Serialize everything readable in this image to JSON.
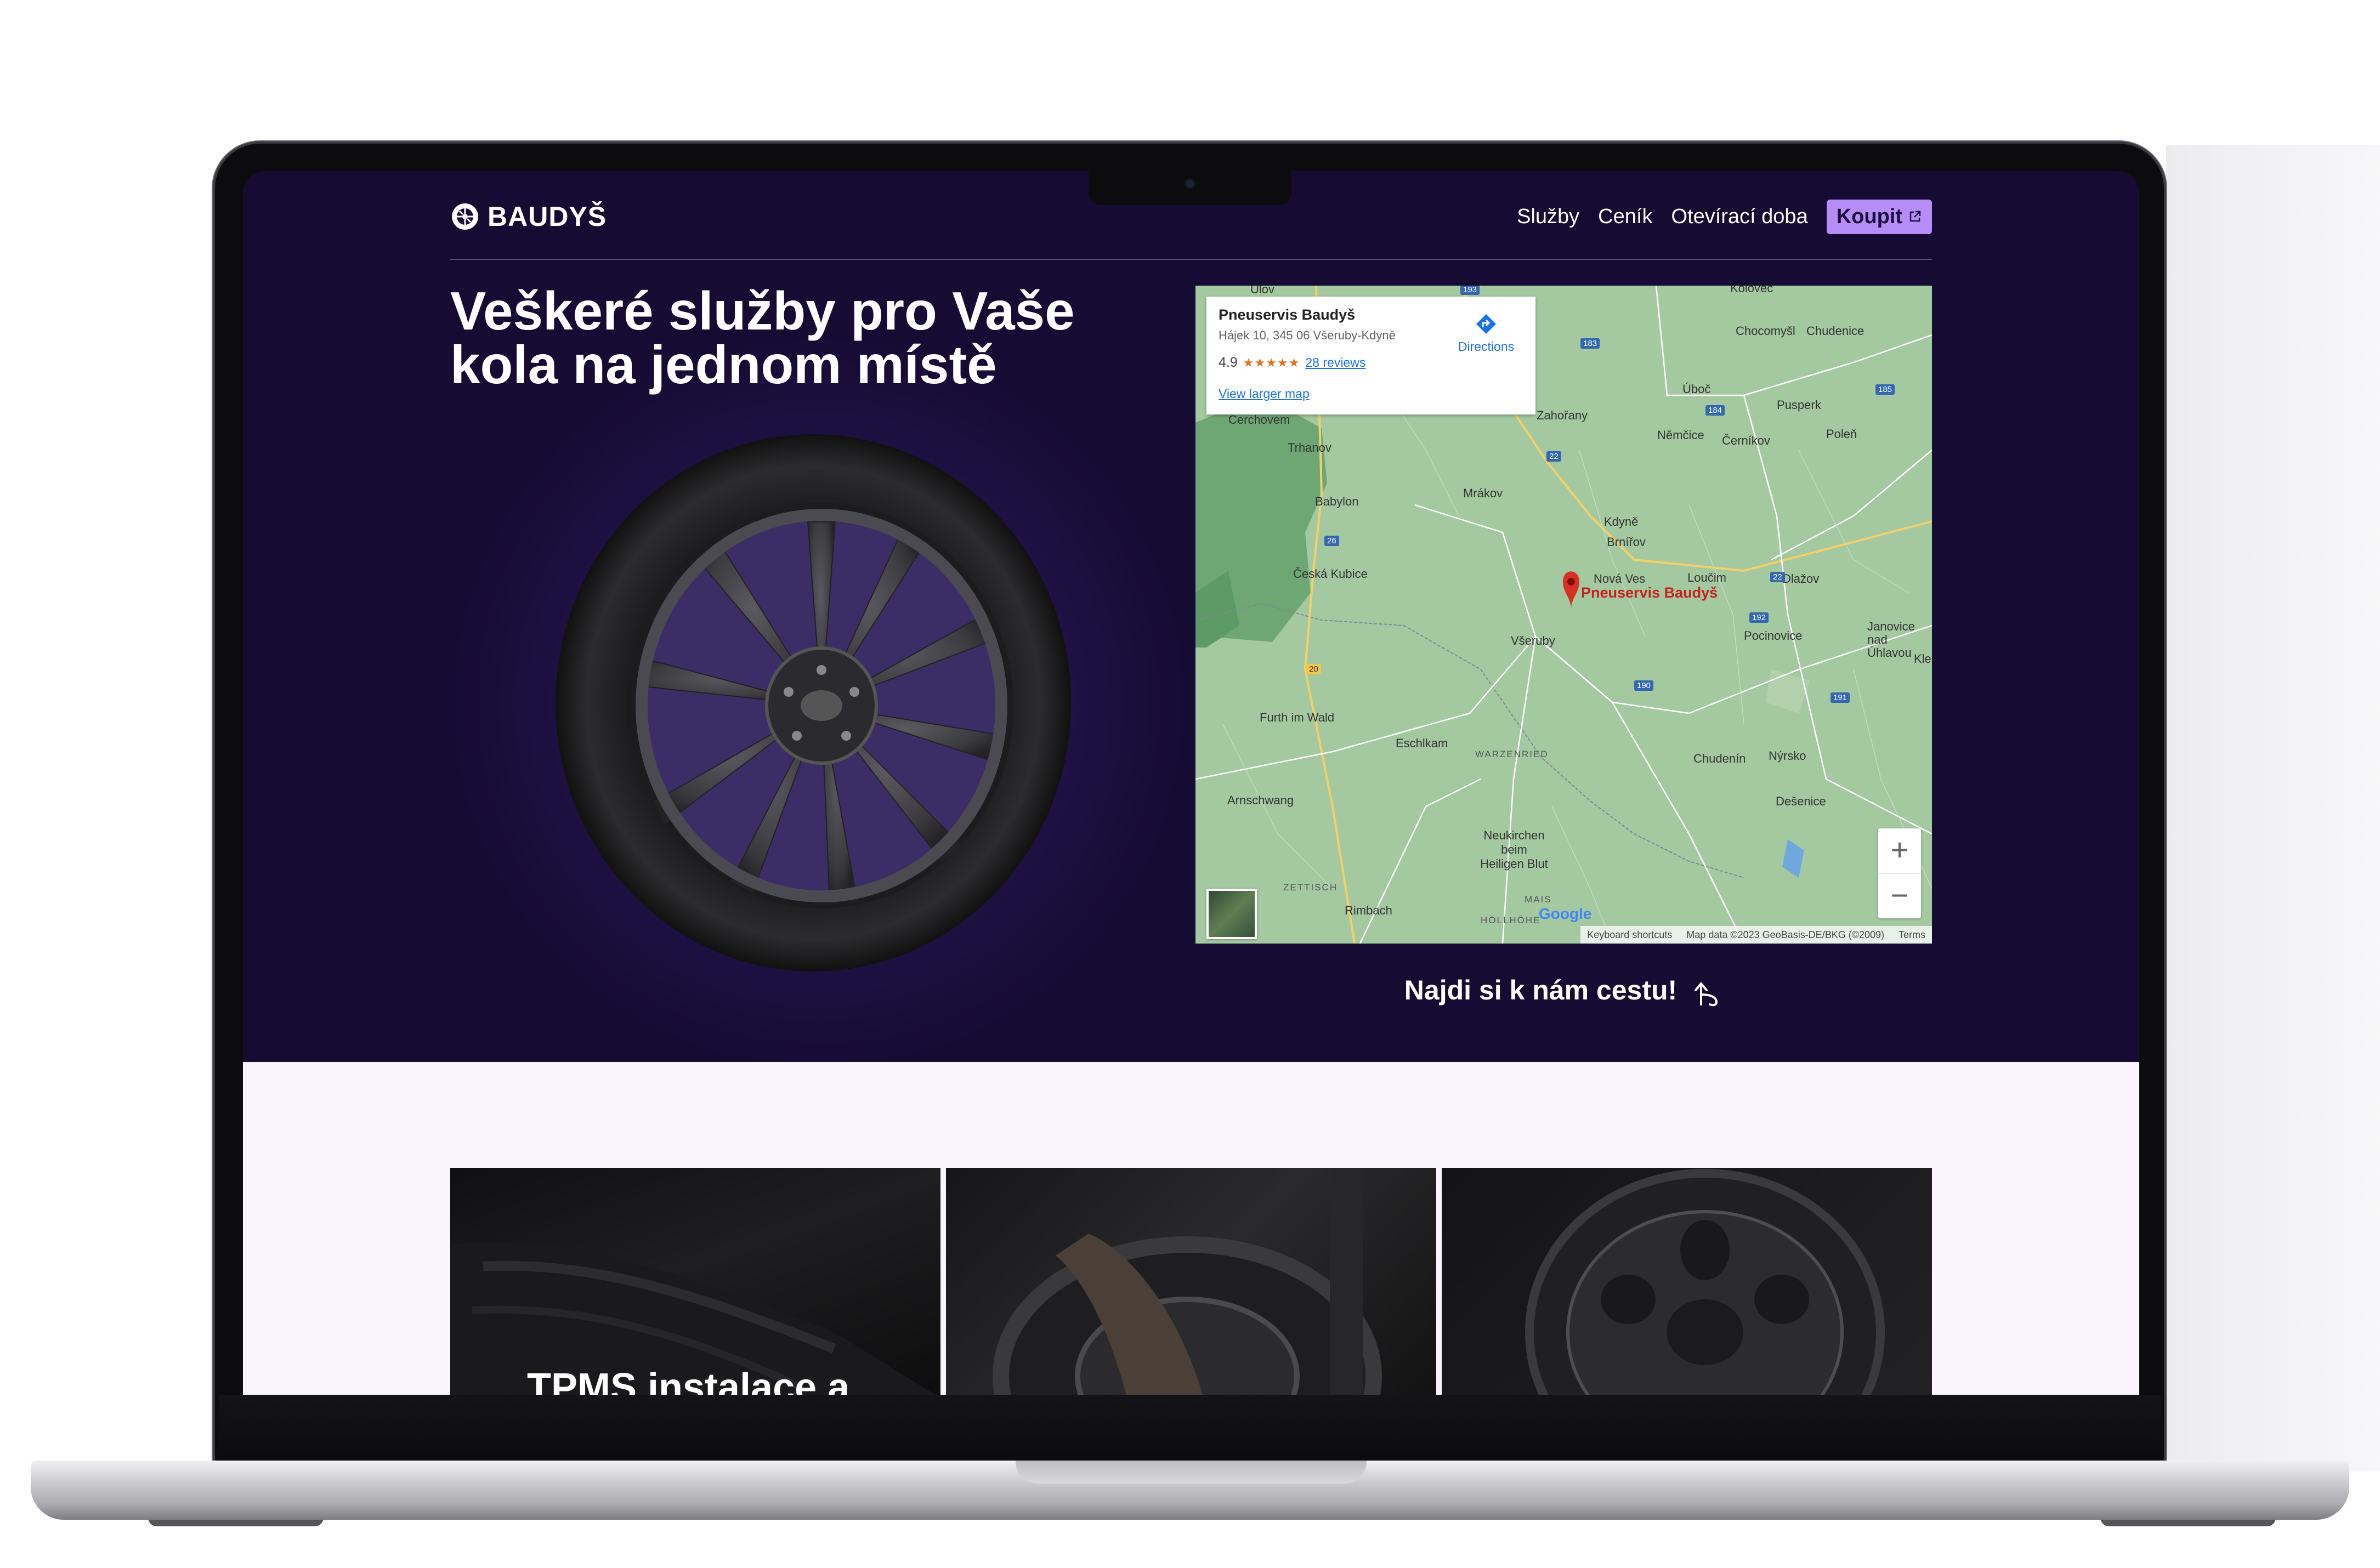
{
  "site": {
    "brand": "BAUDYŠ",
    "nav": {
      "items": [
        "Služby",
        "Ceník",
        "Otevírací doba"
      ],
      "buy_label": "Koupit"
    },
    "hero": {
      "headline_line1": "Veškeré služby pro Vaše",
      "headline_line2": "kola na jednom místě",
      "cta": "Najdi si k nám cestu!"
    },
    "map": {
      "card": {
        "place_name": "Pneuservis Baudyš",
        "address": "Hájek 10, 345 06 Všeruby-Kdyně",
        "rating": "4.9",
        "stars": "★★★★★",
        "reviews": "28 reviews",
        "larger_map": "View larger map",
        "directions": "Directions"
      },
      "pin_label": "Pneuservis Baudyš",
      "places": [
        "Cerchovem",
        "Trhanov",
        "Babylon",
        "Česká Kubice",
        "Mrákov",
        "Zahořany",
        "Kdyně",
        "Brnířov",
        "Nová Ves",
        "Všeruby",
        "Úboč",
        "Němčice",
        "Chocomyšl",
        "Chudenice",
        "Pusperk",
        "Černíkov",
        "Poleň",
        "Loučim",
        "Dlažov",
        "Pocinovice",
        "Janovice nad Úhlavou",
        "Kleń",
        "Furth im Wald",
        "Eschlkam",
        "Chudenín",
        "Nýrsko",
        "Dešenice",
        "Arnschwang",
        "Neukirchen beim Heiligen Blut",
        "Rimbach",
        "Kolovec",
        "Ulov"
      ],
      "areas": [
        "WARZENRIED",
        "ZETTISCH",
        "MAIS",
        "HÖLLHÖHE"
      ],
      "routes": [
        "193",
        "183",
        "184",
        "185",
        "22",
        "26",
        "20",
        "192",
        "190",
        "191",
        "22"
      ],
      "zoom_in": "+",
      "zoom_out": "−",
      "google": "Google",
      "attribution": [
        "Keyboard shortcuts",
        "Map data ©2023 GeoBasis-DE/BKG (©2009)",
        "Terms"
      ]
    },
    "services": {
      "cards": [
        {
          "title": "TPMS instalace a"
        },
        {
          "title": ""
        },
        {
          "title": ""
        }
      ]
    },
    "colors": {
      "hero_bg": "#160b33",
      "accent": "#b68cf7",
      "services_bg": "#f9f4fd"
    }
  }
}
